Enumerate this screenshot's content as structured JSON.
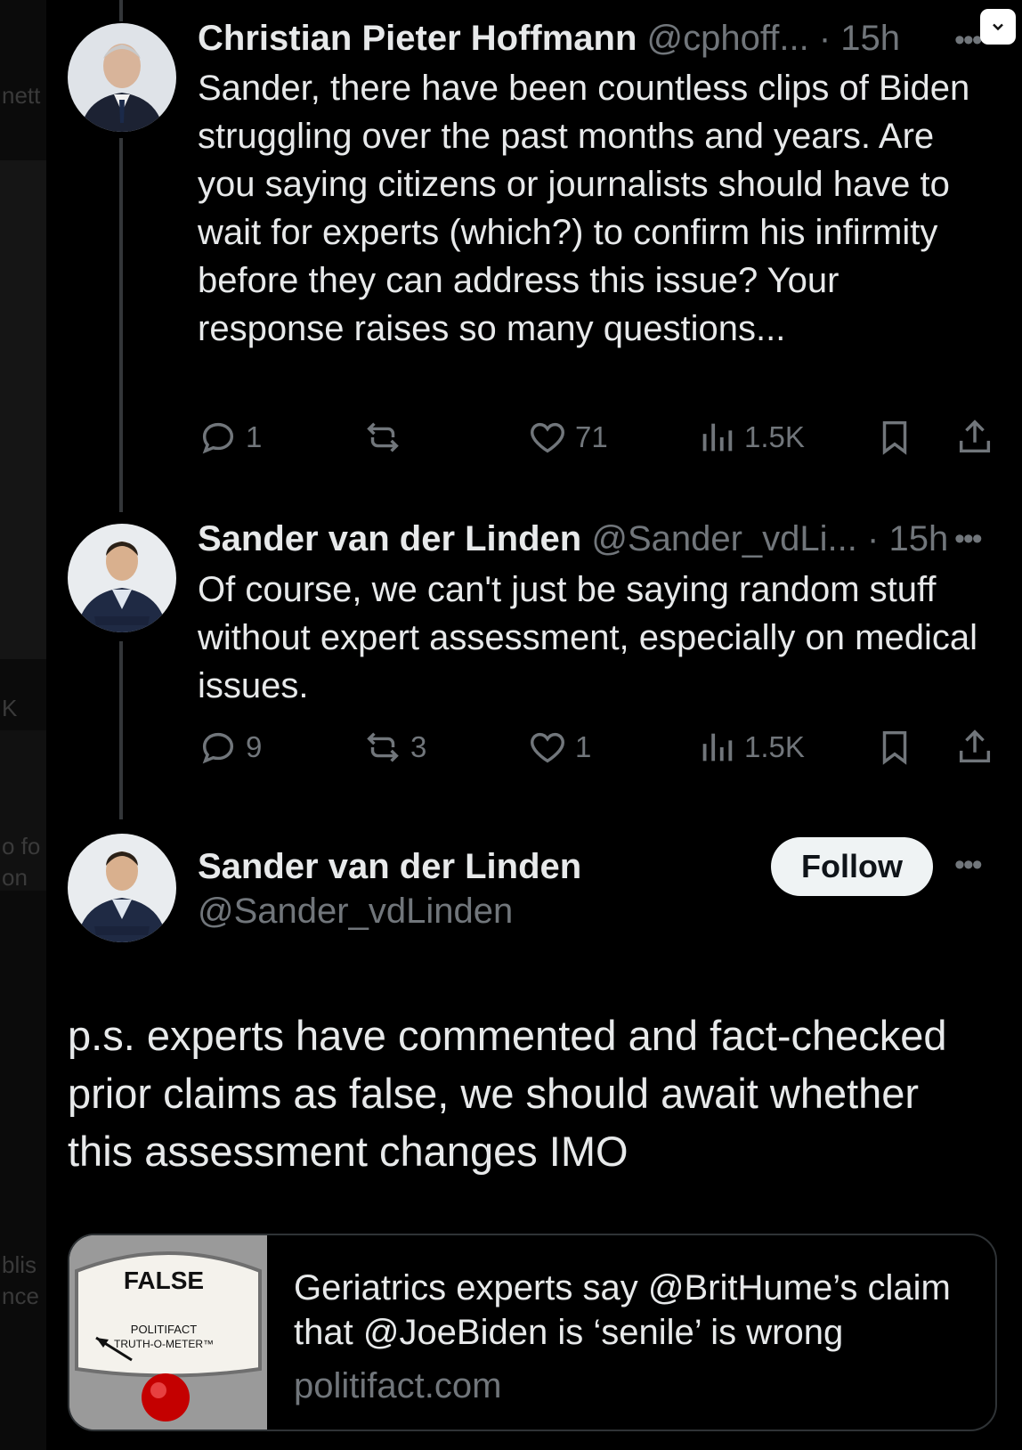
{
  "left_fragments": [
    "nett",
    "K",
    "o fo",
    "on",
    "blis",
    "nce"
  ],
  "tweets": [
    {
      "name": "Christian Pieter Hoffmann",
      "handle": "@cphoff...",
      "time": "· 15h",
      "text": "Sander, there have been countless clips of Biden struggling over the past months and years. Are you saying citizens or journalists should have to wait for experts (which?) to confirm his infirmity before they can address this issue? Your response raises so many questions...",
      "replies": "1",
      "reposts": "",
      "likes": "71",
      "views": "1.5K"
    },
    {
      "name": "Sander van der Linden",
      "handle": "@Sander_vdLi...",
      "time": "· 15h",
      "text": "Of course, we can't just be saying random stuff without expert assessment, especially on medical issues.",
      "replies": "9",
      "reposts": "3",
      "likes": "1",
      "views": "1.5K"
    }
  ],
  "main_tweet": {
    "name": "Sander van der Linden",
    "handle": "@Sander_vdLinden",
    "follow_label": "Follow",
    "text": "p.s. experts have commented and fact-checked prior claims as false, we should await whether this assessment changes IMO",
    "card": {
      "title": "Geriatrics experts say @BritHume’s claim that @JoeBiden is ‘senile’ is wrong",
      "domain": "politifact.com",
      "image_label_false": "FALSE",
      "image_label_brand": "POLITIFACT",
      "image_label_meter": "TRUTH-O-METER™"
    }
  },
  "more_glyph": "•••",
  "colors": {
    "background": "#000000",
    "text_primary": "#e7e9ea",
    "text_secondary": "#71767b",
    "border": "#2f3336",
    "follow_bg": "#eff3f4"
  }
}
